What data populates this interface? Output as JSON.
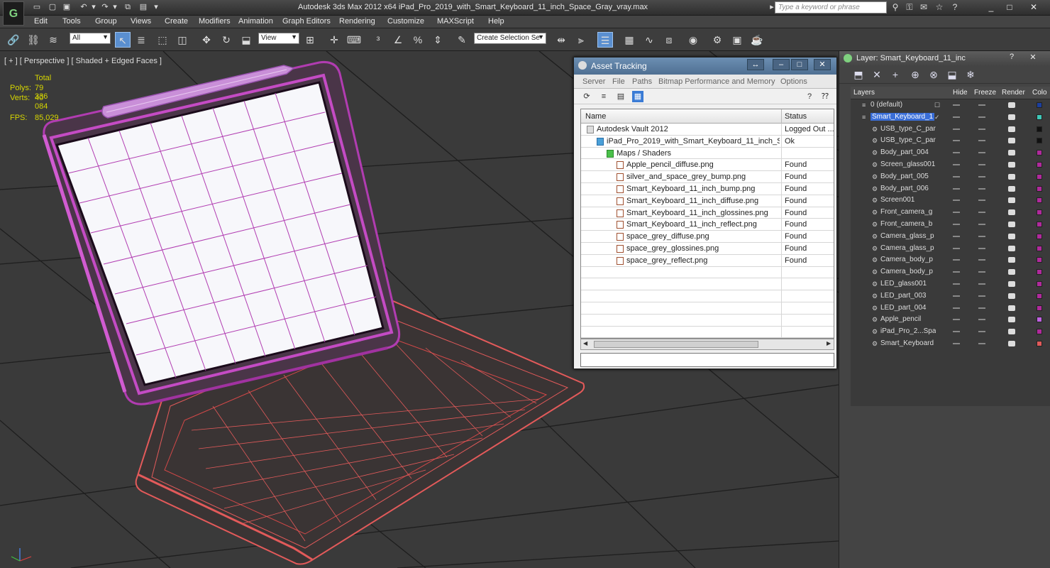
{
  "titlebar": {
    "title": "Autodesk 3ds Max  2012 x64      iPad_Pro_2019_with_Smart_Keyboard_11_inch_Space_Gray_vray.max",
    "search_placeholder": "Type a keyword or phrase",
    "app_logo_letter": "G"
  },
  "menu": [
    "Edit",
    "Tools",
    "Group",
    "Views",
    "Create",
    "Modifiers",
    "Animation",
    "Graph Editors",
    "Rendering",
    "Customize",
    "MAXScript",
    "Help"
  ],
  "toolbar": {
    "filter_value": "All",
    "ref_coord_value": "View",
    "selection_set_value": "Create Selection Se"
  },
  "viewport": {
    "label": "[ + ] [ Perspective ] [ Shaded + Edged Faces ]",
    "stats": {
      "total_label": "Total",
      "polys_label": "Polys:",
      "polys_value": "79 336",
      "verts_label": "Verts:",
      "verts_value": "40 084",
      "fps_label": "FPS:",
      "fps_value": "85,029"
    },
    "colors": {
      "tablet_wire": "#b13cb1",
      "keyboard_wire": "#e35a5a",
      "screen": "#f7f7fb",
      "grid": "#1e1e1e"
    }
  },
  "asset_tracking": {
    "title": "Asset Tracking",
    "menu": [
      "Server",
      "File",
      "Paths",
      "Bitmap Performance and Memory",
      "Options"
    ],
    "columns": {
      "name": "Name",
      "status": "Status"
    },
    "rows": [
      {
        "name": "Autodesk Vault 2012",
        "status": "Logged Out ...",
        "indent": 0
      },
      {
        "name": "iPad_Pro_2019_with_Smart_Keyboard_11_inch_S...",
        "status": "Ok",
        "indent": 1
      },
      {
        "name": "Maps / Shaders",
        "status": "",
        "indent": 2
      },
      {
        "name": "Apple_pencil_diffuse.png",
        "status": "Found",
        "indent": 3
      },
      {
        "name": "silver_and_space_grey_bump.png",
        "status": "Found",
        "indent": 3
      },
      {
        "name": "Smart_Keyboard_11_inch_bump.png",
        "status": "Found",
        "indent": 3
      },
      {
        "name": "Smart_Keyboard_11_inch_diffuse.png",
        "status": "Found",
        "indent": 3
      },
      {
        "name": "Smart_Keyboard_11_inch_glossines.png",
        "status": "Found",
        "indent": 3
      },
      {
        "name": "Smart_Keyboard_11_inch_reflect.png",
        "status": "Found",
        "indent": 3
      },
      {
        "name": "space_grey_diffuse.png",
        "status": "Found",
        "indent": 3
      },
      {
        "name": "space_grey_glossines.png",
        "status": "Found",
        "indent": 3
      },
      {
        "name": "space_grey_reflect.png",
        "status": "Found",
        "indent": 3
      }
    ]
  },
  "layer_panel": {
    "title": "Layer: Smart_Keyboard_11_inc",
    "columns": {
      "layers": "Layers",
      "hide": "Hide",
      "freeze": "Freeze",
      "render": "Render",
      "color": "Colo"
    },
    "rows": [
      {
        "name": "0 (default)",
        "level": 0,
        "color": "#1c3f9e"
      },
      {
        "name": "Smart_Keyboard_1",
        "level": 0,
        "color": "#3ec8b8",
        "selected": true
      },
      {
        "name": "USB_type_C_par",
        "level": 1,
        "color": "#111111"
      },
      {
        "name": "USB_type_C_par",
        "level": 1,
        "color": "#111111"
      },
      {
        "name": "Body_part_004",
        "level": 1,
        "color": "#b02a9c"
      },
      {
        "name": "Screen_glass001",
        "level": 1,
        "color": "#b02a9c"
      },
      {
        "name": "Body_part_005",
        "level": 1,
        "color": "#b02a9c"
      },
      {
        "name": "Body_part_006",
        "level": 1,
        "color": "#b02a9c"
      },
      {
        "name": "Screen001",
        "level": 1,
        "color": "#b02a9c"
      },
      {
        "name": "Front_camera_g",
        "level": 1,
        "color": "#b02a9c"
      },
      {
        "name": "Front_camera_b",
        "level": 1,
        "color": "#b02a9c"
      },
      {
        "name": "Camera_glass_p",
        "level": 1,
        "color": "#b02a9c"
      },
      {
        "name": "Camera_glass_p",
        "level": 1,
        "color": "#b02a9c"
      },
      {
        "name": "Camera_body_p",
        "level": 1,
        "color": "#b02a9c"
      },
      {
        "name": "Camera_body_p",
        "level": 1,
        "color": "#b02a9c"
      },
      {
        "name": "LED_glass001",
        "level": 1,
        "color": "#b02a9c"
      },
      {
        "name": "LED_part_003",
        "level": 1,
        "color": "#b02a9c"
      },
      {
        "name": "LED_part_004",
        "level": 1,
        "color": "#b02a9c"
      },
      {
        "name": "Apple_pencil",
        "level": 1,
        "color": "#c060e0"
      },
      {
        "name": "iPad_Pro_2...Spa",
        "level": 1,
        "color": "#b02a9c"
      },
      {
        "name": "Smart_Keyboard",
        "level": 1,
        "color": "#e05a5a"
      }
    ]
  }
}
